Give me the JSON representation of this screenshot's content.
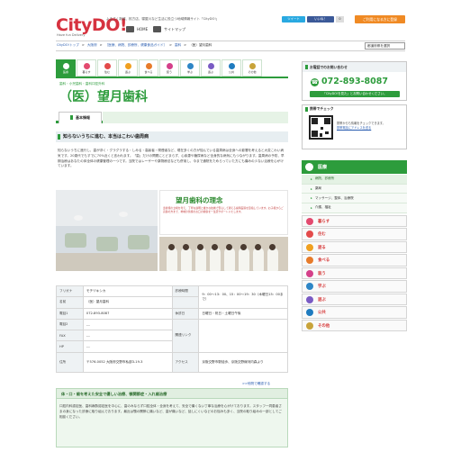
{
  "header": {
    "logo_text": "CityDO!",
    "logo_tag": "Have fun Delivery",
    "tagline": "よるさく新城、枚方店、寝屋川など生活に役立つ地域情報サイト「CityDO!」",
    "home_label": "HOME",
    "sitemap_label": "サイトマップ",
    "tweet_label": "ツイート",
    "like_label": "いいね！",
    "like_count": "0",
    "login_label": "ご利用になる方に登録"
  },
  "breadcrumb": {
    "items": [
      "CityDO!トップ",
      "大阪府",
      "［医療、病院、診療所、健康食品ガイド］",
      "歯科",
      "（医）望月歯科"
    ],
    "separator": ">"
  },
  "pref_select": {
    "value": "都道府県を選択"
  },
  "category_tabs": [
    {
      "label": "医療",
      "color": "#2d9c3c"
    },
    {
      "label": "暮らす",
      "color": "#e34a6f"
    },
    {
      "label": "住む",
      "color": "#e34a4a"
    },
    {
      "label": "遊ぶ",
      "color": "#f0a020"
    },
    {
      "label": "食べる",
      "color": "#e77b2a"
    },
    {
      "label": "装う",
      "color": "#d4408a"
    },
    {
      "label": "学ぶ",
      "color": "#2e86c6"
    },
    {
      "label": "遊ぶ",
      "color": "#7a5bc4"
    },
    {
      "label": "公共",
      "color": "#1f7bbf"
    },
    {
      "label": "その他",
      "color": "#c8a33a"
    }
  ],
  "page": {
    "sub_category": "歯科・小児歯科・歯科口腔外科",
    "clinic_name": "（医）望月歯科",
    "tab_basic": "基本情報",
    "section_heading": "知らないうちに進む、本当はこわい歯周病",
    "intro": "知らないうちに進行し、歯が浮く・グラグラする・しみる・高齢者・喫煙者など、現在多くの方が悩んでいる歯周病は全身への影響を考えると大変こわい病気です。20歳代でもすでに70%近くと言われます。「歯」だけの問題にとどまらず、心疾患や糖尿病など全身的な病気にもつながります。歯周病の予防、早期治療はあなたの体全体の健康管理の一つです。当院ではレーザーや薬物療法なども併用し、今まで通院をためらっていた方にも痛みの少ない治療を心がけています。",
    "concept_title": "望月歯科の理念",
    "concept_text": "患者様の立場を考え、丁寧な説明と確かな技術で安心して通える歯科医院を目指しています。お子様からご高齢の方まで、地域の皆様のお口の健康を一生涯サポートいたします。",
    "back_link": ">>他院で確認する"
  },
  "info_table": [
    {
      "k1": "フリガナ",
      "v1": "モチヅキシカ",
      "k2": "診療時間",
      "v2": "9：00〜13：00、15：00〜19：30（木曜日15：00まで）"
    },
    {
      "k1": "名前",
      "v1": "（医）望月歯科",
      "k2": "",
      "v2": ""
    },
    {
      "k1": "電話1",
      "v1": "072-893-8087",
      "k2": "休診日",
      "v2": "日曜日・祝日・土曜日午後"
    },
    {
      "k1": "電話2",
      "v1": "---",
      "k2": "関連リンク",
      "v2": ""
    },
    {
      "k1": "FAX",
      "v1": "---",
      "k2": "",
      "v2": ""
    },
    {
      "k1": "HP",
      "v1": "---",
      "k2": "",
      "v2": ""
    },
    {
      "k1": "住所",
      "v1": "〒576-0052 大阪府交野市私部3-19-3",
      "k2": "アクセス",
      "v2": "京阪交野市駅徒歩、京阪交野線河内森より"
    }
  ],
  "feature": {
    "title": "体・口・歯を考えた安全で優しい治療、顎関節症・入れ歯治療",
    "text": "口腔内科認定医、歯科麻酔認定医を中心に、歯のみならず口腔全体・全身を考えて、安全で痛くない丁寧な治療を心がけております。スタッフ一同患者さまの身になった診療に取り組んでおります。最近は顎の関節に痛いなど、歯が痛いなど、話しにくいなどのお悩みも多く、当院の取り組みの一部としてご相談ください。"
  },
  "sidebar": {
    "tel_heading": "お電話でのお問い合わせ",
    "tel_number": "072-893-8087",
    "tel_note": "「CityDO!を見た」とお問い合わせください。",
    "mobile_heading": "携帯でチェック",
    "mobile_text": "携帯からも情報をチェックできます。",
    "mobile_link": "携帯電話にアドレスを送る",
    "nav_main": "医療",
    "nav_subs": [
      "病院、診療所",
      "薬局",
      "マッサージ、整体、治療院",
      "介護、福祉"
    ],
    "nav_items": [
      {
        "label": "暮らす",
        "color": "#e34a6f"
      },
      {
        "label": "住む",
        "color": "#e34a4a"
      },
      {
        "label": "遊る",
        "color": "#f0a020"
      },
      {
        "label": "食べる",
        "color": "#e77b2a"
      },
      {
        "label": "装う",
        "color": "#d4408a"
      },
      {
        "label": "学ぶ",
        "color": "#2e86c6"
      },
      {
        "label": "遊ぶ",
        "color": "#7a5bc4"
      },
      {
        "label": "公共",
        "color": "#1f7bbf"
      },
      {
        "label": "その他",
        "color": "#c8a33a"
      }
    ]
  },
  "colors": {
    "brand_green": "#2d9c3c",
    "logo_red": "#d6323f",
    "link_blue": "#2a5db0"
  }
}
